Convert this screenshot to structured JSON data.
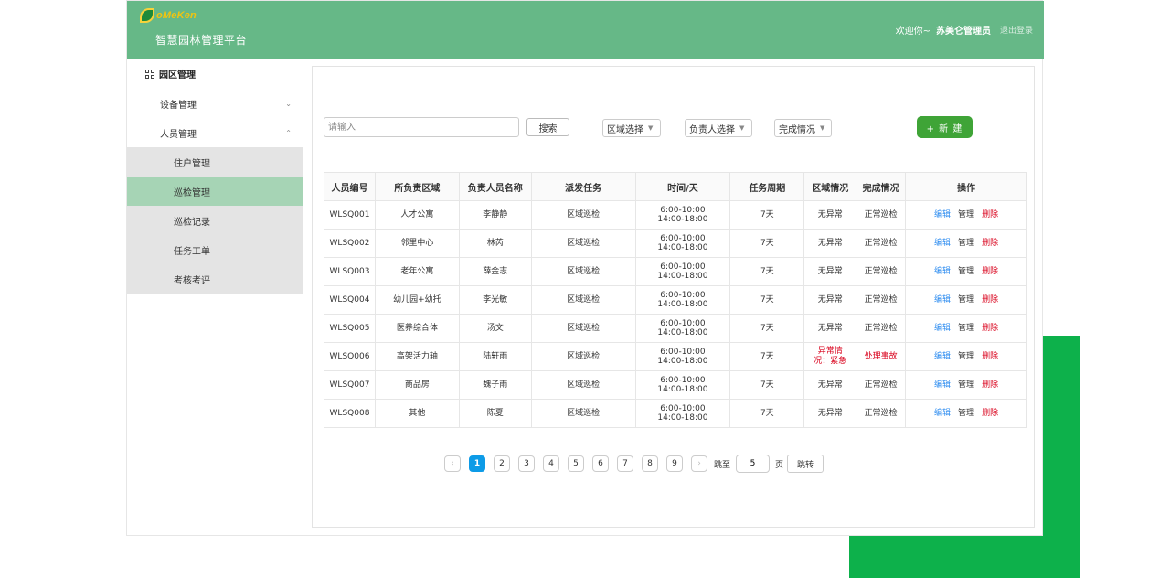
{
  "header": {
    "logo_text": "oMeKen",
    "platform_title": "智慧园林管理平台",
    "welcome": "欢迎你~",
    "username": "苏美仑管理员",
    "logout": "退出登录"
  },
  "sidebar": {
    "top_item": "园区管理",
    "items": [
      {
        "label": "设备管理",
        "chevron": "⌄"
      },
      {
        "label": "人员管理",
        "chevron": "⌃"
      }
    ],
    "subitems": [
      "住户管理",
      "巡检管理",
      "巡检记录",
      "任务工单",
      "考核考评"
    ],
    "active_subitem": "巡检管理"
  },
  "toolbar": {
    "search_placeholder": "请输入",
    "search_button": "搜索",
    "area_select": "区域选择",
    "owner_select": "负责人选择",
    "status_select": "完成情况",
    "new_button": "+ 新 建"
  },
  "table": {
    "columns": [
      "人员编号",
      "所负责区域",
      "负责人员名称",
      "派发任务",
      "时间/天",
      "任务周期",
      "区域情况",
      "完成情况",
      "操作"
    ],
    "actions": {
      "edit": "编辑",
      "manage": "管理",
      "delete": "删除"
    },
    "rows": [
      {
        "id": "WLSQ001",
        "area": "人才公寓",
        "owner": "李静静",
        "task": "区域巡检",
        "time1": "6:00-10:00",
        "time2": "14:00-18:00",
        "period": "7天",
        "area_status": "无异常",
        "completion": "正常巡检",
        "abnormal": false
      },
      {
        "id": "WLSQ002",
        "area": "邻里中心",
        "owner": "林芮",
        "task": "区域巡检",
        "time1": "6:00-10:00",
        "time2": "14:00-18:00",
        "period": "7天",
        "area_status": "无异常",
        "completion": "正常巡检",
        "abnormal": false
      },
      {
        "id": "WLSQ003",
        "area": "老年公寓",
        "owner": "薛金志",
        "task": "区域巡检",
        "time1": "6:00-10:00",
        "time2": "14:00-18:00",
        "period": "7天",
        "area_status": "无异常",
        "completion": "正常巡检",
        "abnormal": false
      },
      {
        "id": "WLSQ004",
        "area": "幼儿园+幼托",
        "owner": "李光敏",
        "task": "区域巡检",
        "time1": "6:00-10:00",
        "time2": "14:00-18:00",
        "period": "7天",
        "area_status": "无异常",
        "completion": "正常巡检",
        "abnormal": false
      },
      {
        "id": "WLSQ005",
        "area": "医养综合体",
        "owner": "汤文",
        "task": "区域巡检",
        "time1": "6:00-10:00",
        "time2": "14:00-18:00",
        "period": "7天",
        "area_status": "无异常",
        "completion": "正常巡检",
        "abnormal": false
      },
      {
        "id": "WLSQ006",
        "area": "高架活力轴",
        "owner": "陆轩雨",
        "task": "区域巡检",
        "time1": "6:00-10:00",
        "time2": "14:00-18:00",
        "period": "7天",
        "area_status": "异常情况：紧急",
        "completion": "处理事故",
        "abnormal": true
      },
      {
        "id": "WLSQ007",
        "area": "商品房",
        "owner": "魏子雨",
        "task": "区域巡检",
        "time1": "6:00-10:00",
        "time2": "14:00-18:00",
        "period": "7天",
        "area_status": "无异常",
        "completion": "正常巡检",
        "abnormal": false
      },
      {
        "id": "WLSQ008",
        "area": "其他",
        "owner": "陈夏",
        "task": "区域巡检",
        "time1": "6:00-10:00",
        "time2": "14:00-18:00",
        "period": "7天",
        "area_status": "无异常",
        "completion": "正常巡检",
        "abnormal": false
      }
    ]
  },
  "pagination": {
    "prev": "‹",
    "next": "›",
    "pages": [
      "1",
      "2",
      "3",
      "4",
      "5",
      "6",
      "7",
      "8",
      "9"
    ],
    "current": "1",
    "goto_label": "跳至",
    "goto_value": "5",
    "page_unit": "页",
    "jump_button": "跳转"
  },
  "colors": {
    "header": "#66b887",
    "active_menu": "#a6d4b5",
    "primary_button": "#3fa437",
    "pager_active": "#0d9be7",
    "danger": "#d9001b",
    "link": "#2d8cf0",
    "decor": "#0db14b"
  }
}
